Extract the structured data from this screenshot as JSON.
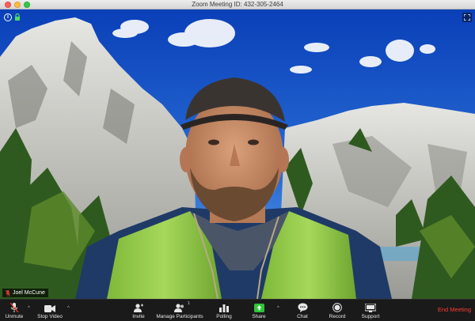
{
  "window": {
    "title": "Zoom Meeting ID: 432-305-2464"
  },
  "video": {
    "participant_name": "Joel McCune",
    "info_icon_glyph": "i"
  },
  "toolbar": {
    "unmute_label": "Unmute",
    "stop_video_label": "Stop Video",
    "invite_label": "Invite",
    "manage_participants_label": "Manage Participants",
    "participants_count": "1",
    "polling_label": "Polling",
    "share_label": "Share",
    "chat_label": "Chat",
    "record_label": "Record",
    "support_label": "Support",
    "end_meeting_label": "End Meeting",
    "caret_glyph": "^"
  },
  "colors": {
    "end_meeting": "#ff3b30",
    "share_green": "#2ec53a",
    "toolbar_bg": "#1a1a1a"
  },
  "icons": [
    "info-icon",
    "lock-icon",
    "expand-icon",
    "mic-muted-icon",
    "video-camera-icon",
    "invite-icon",
    "participants-icon",
    "polling-icon",
    "share-screen-icon",
    "chat-icon",
    "record-icon",
    "support-icon"
  ]
}
